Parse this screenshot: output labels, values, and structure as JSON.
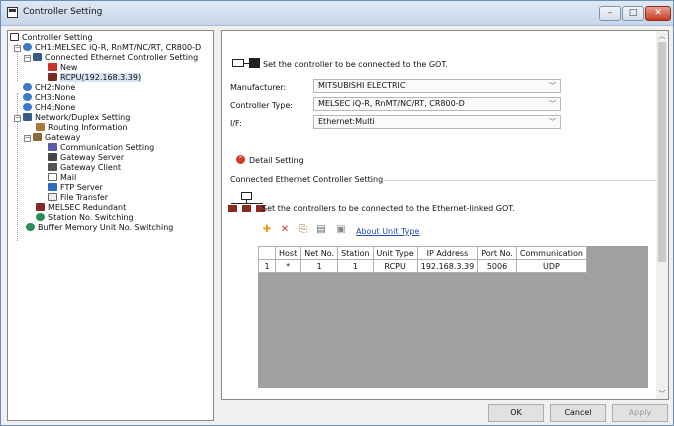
{
  "window": {
    "title": "Controller Setting"
  },
  "tree": {
    "root": "Controller Setting",
    "ch1": "CH1:MELSEC iQ-R, RnMT/NC/RT, CR800-D",
    "ch1_conn": "Connected Ethernet Controller Setting",
    "new": "New",
    "rcpu": "RCPU(192.168.3.39)",
    "ch2": "CH2:None",
    "ch3": "CH3:None",
    "ch4": "CH4:None",
    "network": "Network/Duplex Setting",
    "routing": "Routing Information",
    "gateway": "Gateway",
    "comm_setting": "Communication Setting",
    "gw_server": "Gateway Server",
    "gw_client": "Gateway Client",
    "mail": "Mail",
    "ftp": "FTP Server",
    "file_transfer": "File Transfer",
    "melsec_redundant": "MELSEC Redundant",
    "station_switch": "Station No. Switching",
    "buffer_switch": "Buffer Memory Unit No. Switching"
  },
  "panel": {
    "heading": "Set the controller to be connected to the GOT.",
    "manufacturer_label": "Manufacturer:",
    "manufacturer_value": "MITSUBISHI ELECTRIC",
    "type_label": "Controller Type:",
    "type_value": "MELSEC iQ-R, RnMT/NC/RT, CR800-D",
    "if_label": "I/F:",
    "if_value": "Ethernet:Multi",
    "detail": "Detail Setting",
    "section": "Connected Ethernet Controller Setting",
    "eth_heading": "Set the controllers to be connected to the Ethernet-linked GOT.",
    "about_link": "About Unit Type"
  },
  "table": {
    "headers": [
      "",
      "Host",
      "Net No.",
      "Station",
      "Unit Type",
      "IP Address",
      "Port No.",
      "Communication"
    ],
    "rows": [
      [
        "1",
        "*",
        "1",
        "1",
        "RCPU",
        "192.168.3.39",
        "5006",
        "UDP"
      ]
    ]
  },
  "buttons": {
    "ok": "OK",
    "cancel": "Cancel",
    "apply": "Apply"
  },
  "colors": {
    "accent_red": "#d23c2a",
    "link": "#1a4fb5",
    "tree_selected": "#d6e4f5"
  }
}
